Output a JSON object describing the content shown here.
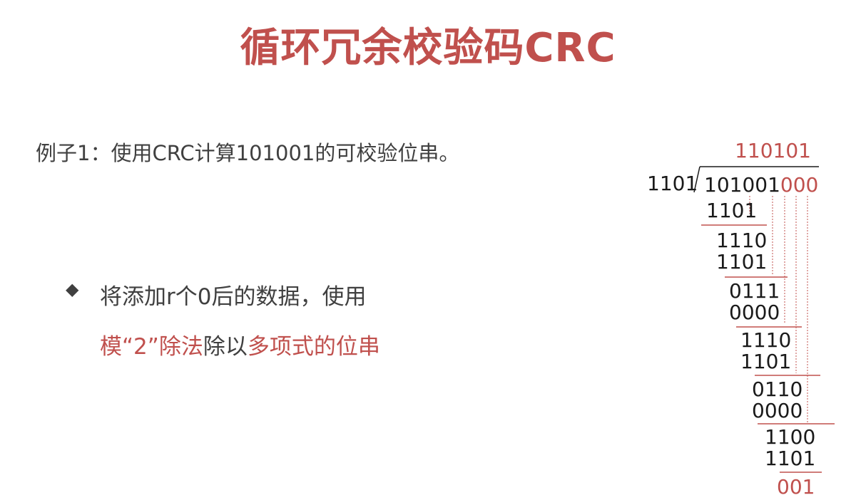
{
  "title": "循环冗余校验码CRC",
  "example": "例子1：使用CRC计算101001的可校验位串。",
  "bullet": {
    "part1": "将添加r个0后的数据，使用",
    "hl1": "模“2”除法",
    "part2": "除以",
    "hl2": "多项式的位串"
  },
  "division": {
    "quotient": "110101",
    "divisor": "1101",
    "dividend_data": "101001",
    "dividend_zeros": "000",
    "steps": [
      "1101",
      "1110",
      "1101",
      "0111",
      "0000",
      "1110",
      "1101",
      "0110",
      "0000",
      "1100",
      "1101"
    ],
    "remainder": "001"
  },
  "colors": {
    "accent": "#c0504d",
    "text": "#404040"
  }
}
